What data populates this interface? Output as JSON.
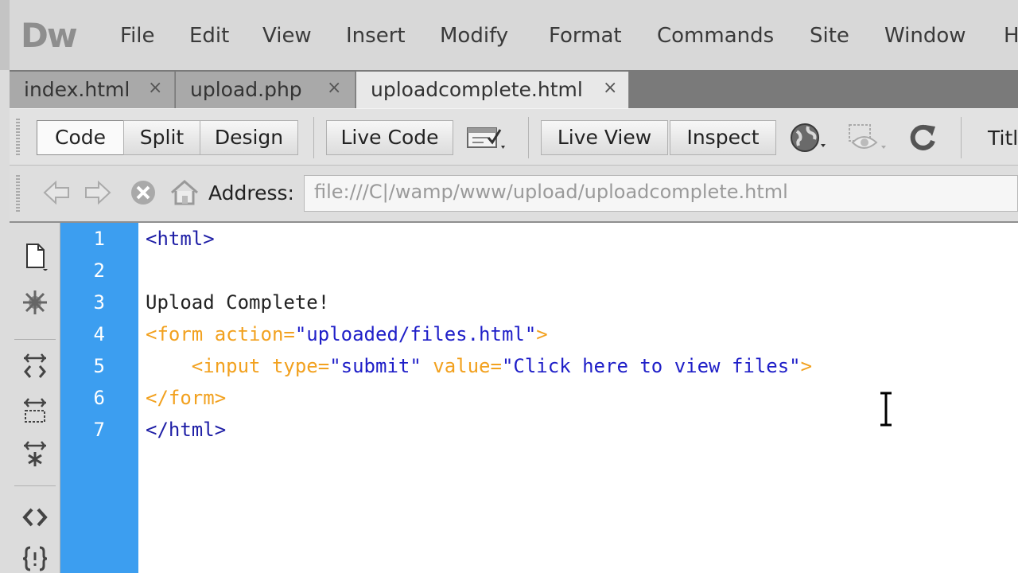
{
  "app": {
    "logo": "Dw"
  },
  "menu": [
    "File",
    "Edit",
    "View",
    "Insert",
    "Modify",
    "Format",
    "Commands",
    "Site",
    "Window",
    "He"
  ],
  "tabs": [
    {
      "label": "index.html",
      "close": "×"
    },
    {
      "label": "upload.php",
      "close": "×"
    },
    {
      "label": "uploadcomplete.html",
      "close": "×",
      "active": true
    }
  ],
  "toolbar": {
    "view_buttons": [
      "Code",
      "Split",
      "Design"
    ],
    "live_code": "Live Code",
    "live_view": "Live View",
    "inspect": "Inspect",
    "title_label": "Titl"
  },
  "address": {
    "label": "Address:",
    "value": "file:///C|/wamp/www/upload/uploadcomplete.html"
  },
  "editor": {
    "line_numbers": [
      "1",
      "2",
      "3",
      "4",
      "5",
      "6",
      "7"
    ],
    "lines": {
      "l1_tag": "<html>",
      "l3_text": "Upload Complete!",
      "l4_open": "<form ",
      "l4_attr": "action=",
      "l4_val": "\"uploaded/files.html\"",
      "l4_close": ">",
      "l5_indent": "    ",
      "l5_open": "<input ",
      "l5_attr1": "type=",
      "l5_val1": "\"submit\"",
      "l5_sp": " ",
      "l5_attr2": "value=",
      "l5_val2": "\"Click here to view files\"",
      "l5_close": ">",
      "l6_tag": "</form>",
      "l7_tag": "</html>"
    }
  },
  "colors": {
    "gutter": "#3c9ef0",
    "tag": "#1f1fa6",
    "attr": "#f2a11f",
    "string": "#1f1fc8"
  }
}
